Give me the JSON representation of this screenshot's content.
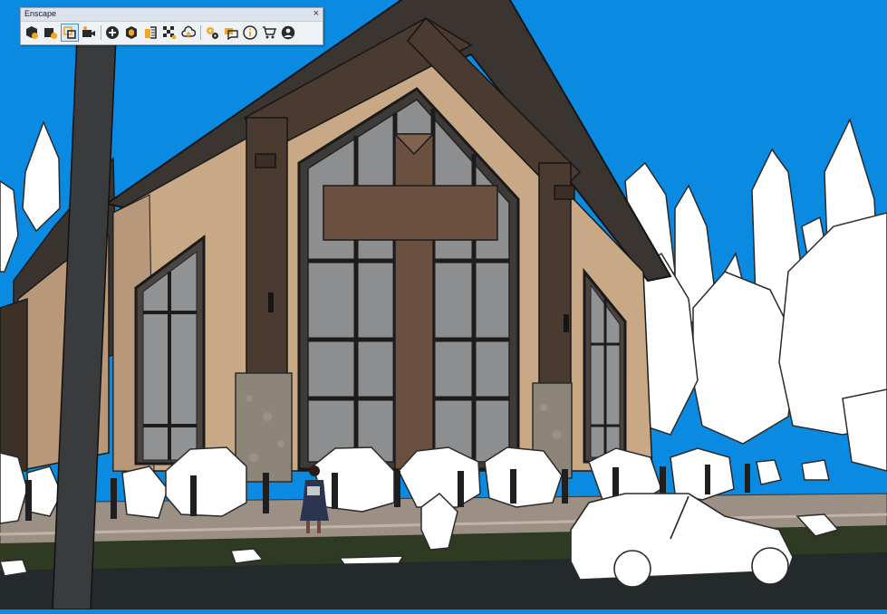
{
  "window": {
    "title": "Enscape",
    "close_glyph": "×"
  },
  "toolbar": {
    "buttons": [
      {
        "icon": "start-enscape-icon",
        "group": 1
      },
      {
        "icon": "live-update-icon",
        "group": 1
      },
      {
        "icon": "synchronize-views-icon",
        "group": 1,
        "active": true
      },
      {
        "icon": "capture-video-icon",
        "group": 1
      },
      {
        "icon": "add-view-icon",
        "group": 2
      },
      {
        "icon": "asset-library-icon",
        "group": 2
      },
      {
        "icon": "material-editor-icon",
        "group": 2
      },
      {
        "icon": "batch-render-icon",
        "group": 2
      },
      {
        "icon": "upload-cloud-icon",
        "group": 2
      },
      {
        "icon": "settings-icon",
        "group": 3
      },
      {
        "icon": "feedback-icon",
        "group": 3
      },
      {
        "icon": "about-icon",
        "group": 3
      },
      {
        "icon": "shop-icon",
        "group": 3
      },
      {
        "icon": "account-icon",
        "group": 3
      }
    ]
  },
  "colors": {
    "sky": "#0a8ae0",
    "walls": "#c9a885",
    "timber": "#4a3a30",
    "stone": "#8c8578",
    "foliage": "#ffffff",
    "lawn": "#2f3a22",
    "road": "#24292b",
    "active_button_border": "#4d8ed8"
  }
}
